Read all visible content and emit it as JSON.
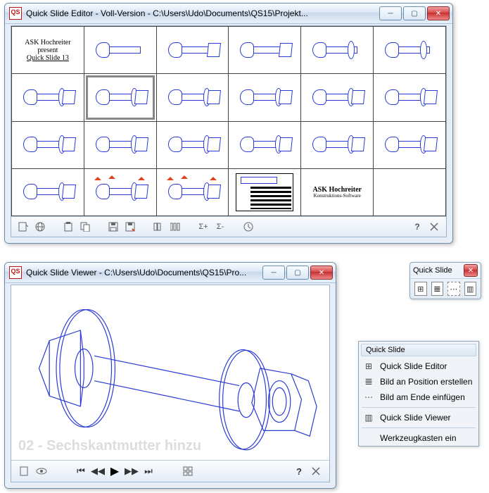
{
  "editor": {
    "title": "Quick Slide Editor - Voll-Version - C:\\Users\\Udo\\Documents\\QS15\\Projekt...",
    "app_icon_text": "QS",
    "thumbs": {
      "intro": {
        "line1": "ASK Hochreiter",
        "line2": "present",
        "line3": "Quick Slide 13"
      },
      "outro": {
        "line1": "ASK Hochreiter",
        "line2": "Konstruktions-Software"
      }
    },
    "toolbar": {
      "new": "new",
      "dup": "dup",
      "paste": "paste",
      "copy": "copy",
      "save": "save",
      "saveas": "saveas",
      "align": "align",
      "distribute": "distribute",
      "zplus": "z+",
      "zminus": "z-",
      "clock": "clock",
      "help": "?",
      "exit": "exit"
    }
  },
  "viewer": {
    "title": "Quick Slide Viewer - C:\\Users\\Udo\\Documents\\QS15\\Pro...",
    "app_icon_text": "QS",
    "watermark": "02 - Sechskantmutter hinzu",
    "buttons": {
      "new": "new",
      "eye": "eye",
      "first": "first",
      "prev": "prev",
      "play": "play",
      "next": "next",
      "last": "last",
      "grid": "grid",
      "help": "?",
      "exit": "exit"
    }
  },
  "float": {
    "title": "Quick Slide"
  },
  "menu": {
    "header": "Quick Slide",
    "items": {
      "editor": "Quick Slide Editor",
      "bildpos": "Bild an Position erstellen",
      "bildende": "Bild am Ende einfügen",
      "viewer": "Quick Slide Viewer",
      "werkzeug": "Werkzeugkasten ein"
    }
  }
}
